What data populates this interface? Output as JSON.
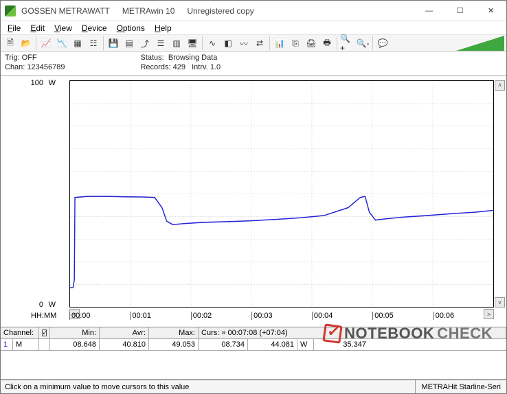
{
  "title": {
    "vendor": "GOSSEN METRAWATT",
    "app": "METRAwin 10",
    "license": "Unregistered copy"
  },
  "menu": {
    "file": "File",
    "edit": "Edit",
    "view": "View",
    "device": "Device",
    "options": "Options",
    "help": "Help"
  },
  "status": {
    "trig_label": "Trig:",
    "trig_value": "OFF",
    "chan_label": "Chan:",
    "chan_value": "123456789",
    "status_label": "Status:",
    "status_value": "Browsing Data",
    "records_label": "Records:",
    "records_value": "429",
    "intrv_label": "Intrv.",
    "intrv_value": "1.0"
  },
  "chart_data": {
    "type": "line",
    "title": "",
    "xlabel": "HH:MM",
    "ylabel": "W",
    "ylim": [
      0,
      100
    ],
    "x_ticks": [
      "00:00",
      "00:01",
      "00:02",
      "00:03",
      "00:04",
      "00:05",
      "00:06"
    ],
    "series": [
      {
        "name": "Channel 1 (M)",
        "unit": "W",
        "color": "#2323d8",
        "x": [
          0.0,
          0.05,
          0.07,
          0.08,
          0.3,
          0.6,
          0.9,
          1.2,
          1.4,
          1.52,
          1.6,
          1.7,
          1.9,
          2.2,
          2.6,
          3.0,
          3.4,
          3.8,
          4.2,
          4.6,
          4.8,
          4.88,
          4.95,
          5.05,
          5.2,
          5.5,
          5.9,
          6.3,
          6.7,
          7.0
        ],
        "values": [
          8.6,
          8.7,
          12,
          48.5,
          49.0,
          49.0,
          48.8,
          48.7,
          48.5,
          44,
          38,
          36.5,
          37.0,
          37.5,
          37.8,
          38.2,
          38.8,
          39.5,
          40.5,
          44.0,
          48.5,
          49.0,
          42,
          38.5,
          39.0,
          39.8,
          40.5,
          41.3,
          42.0,
          42.8
        ]
      }
    ]
  },
  "xaxis_label": "HH:MM",
  "yaxis": {
    "top": "100",
    "bottom": "0",
    "unit": "W"
  },
  "table": {
    "headers": {
      "channel": "Channel:",
      "min": "Min:",
      "avr": "Avr:",
      "max": "Max:",
      "curs": "Curs: » 00:07:08 (+07:04)"
    },
    "row": {
      "idx": "1",
      "mode": "M",
      "min": "08.648",
      "avr": "40.810",
      "max": "49.053",
      "c1": "08.734",
      "c2": "44.081",
      "unit": "W",
      "c3": "35.347"
    }
  },
  "watermark": {
    "brand1": "NOTEBOOK",
    "brand2": "CHECK"
  },
  "bottom": {
    "msg": "Click on a minimum value to move cursors to this value",
    "device": "METRAHit Starline-Seri"
  }
}
